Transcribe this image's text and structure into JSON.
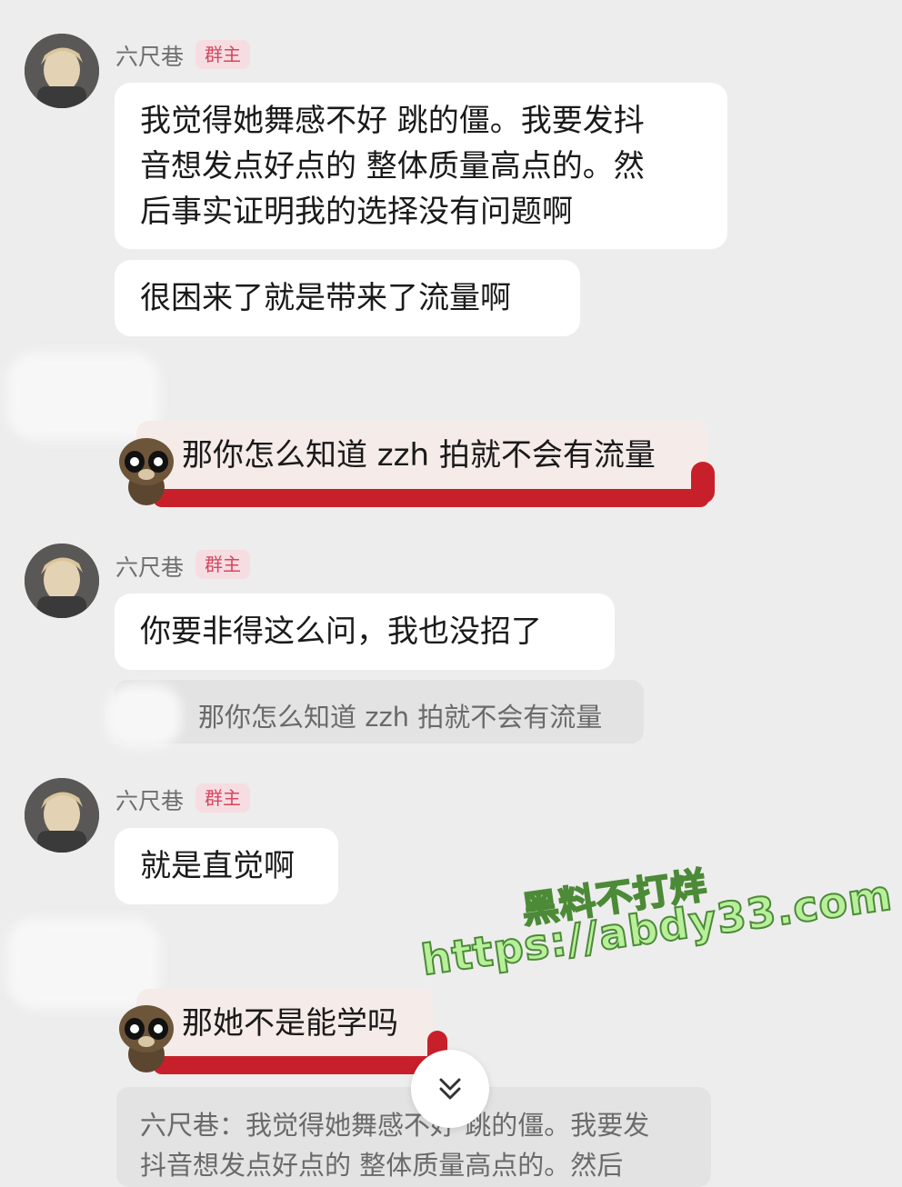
{
  "messages": [
    {
      "sender": "六尺巷",
      "badge": "群主",
      "bubbles": [
        "我觉得她舞感不好 跳的僵。我要发抖\n音想发点好点的 整体质量高点的。然\n后事实证明我的选择没有问题啊",
        "很困来了就是带来了流量啊"
      ]
    },
    {
      "self_text": "那你怎么知道 zzh 拍就不会有流量"
    },
    {
      "sender": "六尺巷",
      "badge": "群主",
      "bubbles": [
        "你要非得这么问，我也没招了"
      ],
      "quote": "那你怎么知道 zzh 拍就不会有流量"
    },
    {
      "sender": "六尺巷",
      "badge": "群主",
      "bubbles": [
        "就是直觉啊"
      ]
    },
    {
      "self_text": "那她不是能学吗"
    }
  ],
  "bottom_quote": "六尺巷：我觉得她舞感不好 跳的僵。我要发\n抖音想发点好点的 整体质量高点的。然后",
  "watermark": {
    "line1": "黑料不打烊",
    "line2": "https://abdy33.com"
  },
  "icons": {
    "scroll": "chevron-double-down-icon",
    "pet": "raccoon-sticker-icon",
    "avatar": "user-avatar"
  },
  "colors": {
    "background": "#ededed",
    "badge_bg": "#f6dde2",
    "badge_text": "#d4465f",
    "highlight_red": "#c8202a"
  }
}
